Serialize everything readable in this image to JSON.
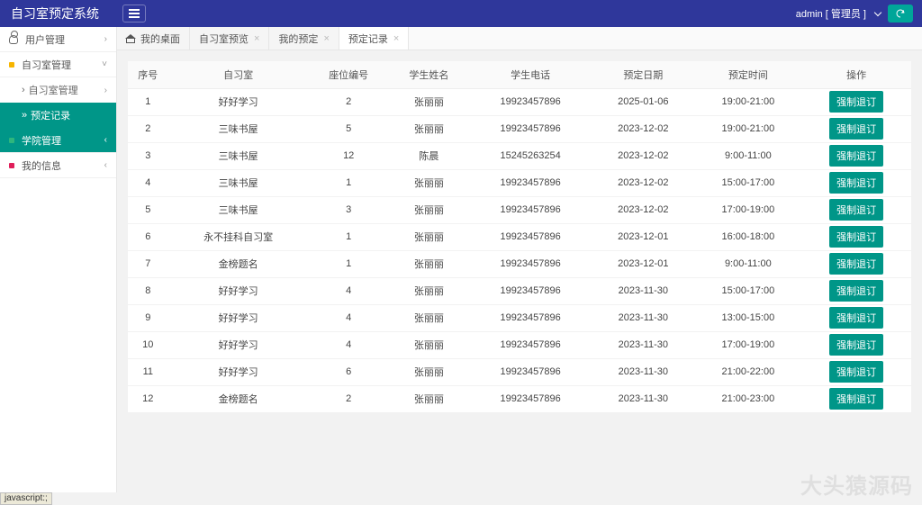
{
  "header": {
    "logo": "自习室预定系统",
    "user_label": "admin [ 管理员 ]"
  },
  "sidebar": {
    "items": [
      {
        "label": "用户管理",
        "arrow": "›",
        "icon": "user"
      },
      {
        "label": "自习室管理",
        "arrow": "˅",
        "icon": "dot",
        "dot_color": "#f7b500"
      },
      {
        "label": "自习室管理",
        "sub": true,
        "arrow": "›"
      },
      {
        "label": "预定记录",
        "sub": true,
        "active": true
      },
      {
        "label": "学院管理",
        "arrow": "‹",
        "icon": "dot",
        "dot_color": "#2eb67d",
        "hl": true
      },
      {
        "label": "我的信息",
        "arrow": "‹",
        "icon": "dot",
        "dot_color": "#e01e5a"
      }
    ]
  },
  "tabs": [
    {
      "label": "我的桌面",
      "home": true
    },
    {
      "label": "自习室预览",
      "closable": true
    },
    {
      "label": "我的预定",
      "closable": true
    },
    {
      "label": "预定记录",
      "closable": true,
      "current": true
    }
  ],
  "table": {
    "headers": [
      "序号",
      "自习室",
      "座位编号",
      "学生姓名",
      "学生电话",
      "预定日期",
      "预定时间",
      "操作"
    ],
    "action_label": "强制退订",
    "rows": [
      {
        "n": 1,
        "room": "好好学习",
        "seat": 2,
        "name": "张丽丽",
        "phone": "19923457896",
        "date": "2025-01-06",
        "time": "19:00-21:00"
      },
      {
        "n": 2,
        "room": "三味书屋",
        "seat": 5,
        "name": "张丽丽",
        "phone": "19923457896",
        "date": "2023-12-02",
        "time": "19:00-21:00"
      },
      {
        "n": 3,
        "room": "三味书屋",
        "seat": 12,
        "name": "陈晨",
        "phone": "15245263254",
        "date": "2023-12-02",
        "time": "9:00-11:00"
      },
      {
        "n": 4,
        "room": "三味书屋",
        "seat": 1,
        "name": "张丽丽",
        "phone": "19923457896",
        "date": "2023-12-02",
        "time": "15:00-17:00"
      },
      {
        "n": 5,
        "room": "三味书屋",
        "seat": 3,
        "name": "张丽丽",
        "phone": "19923457896",
        "date": "2023-12-02",
        "time": "17:00-19:00"
      },
      {
        "n": 6,
        "room": "永不挂科自习室",
        "seat": 1,
        "name": "张丽丽",
        "phone": "19923457896",
        "date": "2023-12-01",
        "time": "16:00-18:00"
      },
      {
        "n": 7,
        "room": "金榜题名",
        "seat": 1,
        "name": "张丽丽",
        "phone": "19923457896",
        "date": "2023-12-01",
        "time": "9:00-11:00"
      },
      {
        "n": 8,
        "room": "好好学习",
        "seat": 4,
        "name": "张丽丽",
        "phone": "19923457896",
        "date": "2023-11-30",
        "time": "15:00-17:00"
      },
      {
        "n": 9,
        "room": "好好学习",
        "seat": 4,
        "name": "张丽丽",
        "phone": "19923457896",
        "date": "2023-11-30",
        "time": "13:00-15:00"
      },
      {
        "n": 10,
        "room": "好好学习",
        "seat": 4,
        "name": "张丽丽",
        "phone": "19923457896",
        "date": "2023-11-30",
        "time": "17:00-19:00"
      },
      {
        "n": 11,
        "room": "好好学习",
        "seat": 6,
        "name": "张丽丽",
        "phone": "19923457896",
        "date": "2023-11-30",
        "time": "21:00-22:00"
      },
      {
        "n": 12,
        "room": "金榜题名",
        "seat": 2,
        "name": "张丽丽",
        "phone": "19923457896",
        "date": "2023-11-30",
        "time": "21:00-23:00"
      }
    ]
  },
  "watermark": "大头猿源码",
  "statusbar": "javascript:;"
}
